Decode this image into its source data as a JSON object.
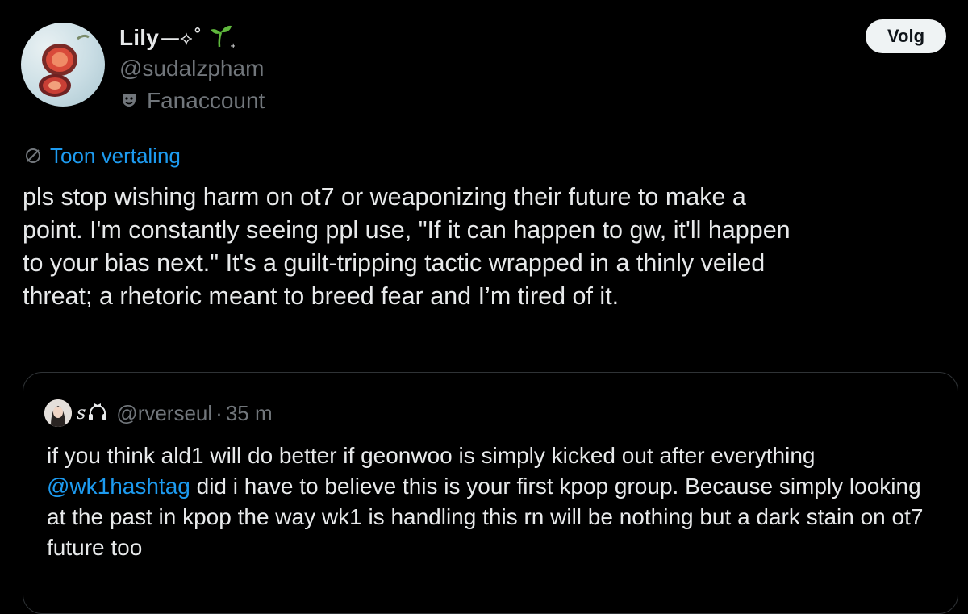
{
  "tweet": {
    "author": {
      "display_name": "Lily",
      "name_decoration": "—⟡˚",
      "decoration_icon": "sprout-icon",
      "handle": "@sudalzpham",
      "account_label_icon": "theater-mask-icon",
      "account_label": "Fanaccount"
    },
    "follow_label": "Volg",
    "translate_icon": "translate-globe-icon",
    "translate_label": "Toon vertaling",
    "text": "pls stop wishing harm on ot7 or weaponizing their future to make a\npoint. I'm constantly seeing ppl use, \"If it can happen to gw, it'll happen\nto your bias next.\" It's a guilt-tripping tactic wrapped in a thinly veiled\nthreat; a rhetoric meant to breed fear and I’m tired of it."
  },
  "quote": {
    "decoration": "ꜱ",
    "decoration_icon": "headphones-bow-icon",
    "handle": "@rverseul",
    "separator": "·",
    "time": "35 m",
    "text_before": "if you think ald1 will do better if geonwoo is simply kicked out after everything ",
    "mention": "@wk1hashtag",
    "text_after": " did i have to believe this is your first kpop group. Because simply looking at the past in kpop the way wk1 is handling this rn will be nothing but a dark stain on ot7 future too"
  },
  "colors": {
    "background": "#000000",
    "text_primary": "#e7e9ea",
    "text_secondary": "#71767b",
    "accent_link": "#1d9bf0",
    "border": "#2f3336",
    "follow_button_bg": "#eff3f4",
    "sprout_green": "#5fb83d"
  }
}
